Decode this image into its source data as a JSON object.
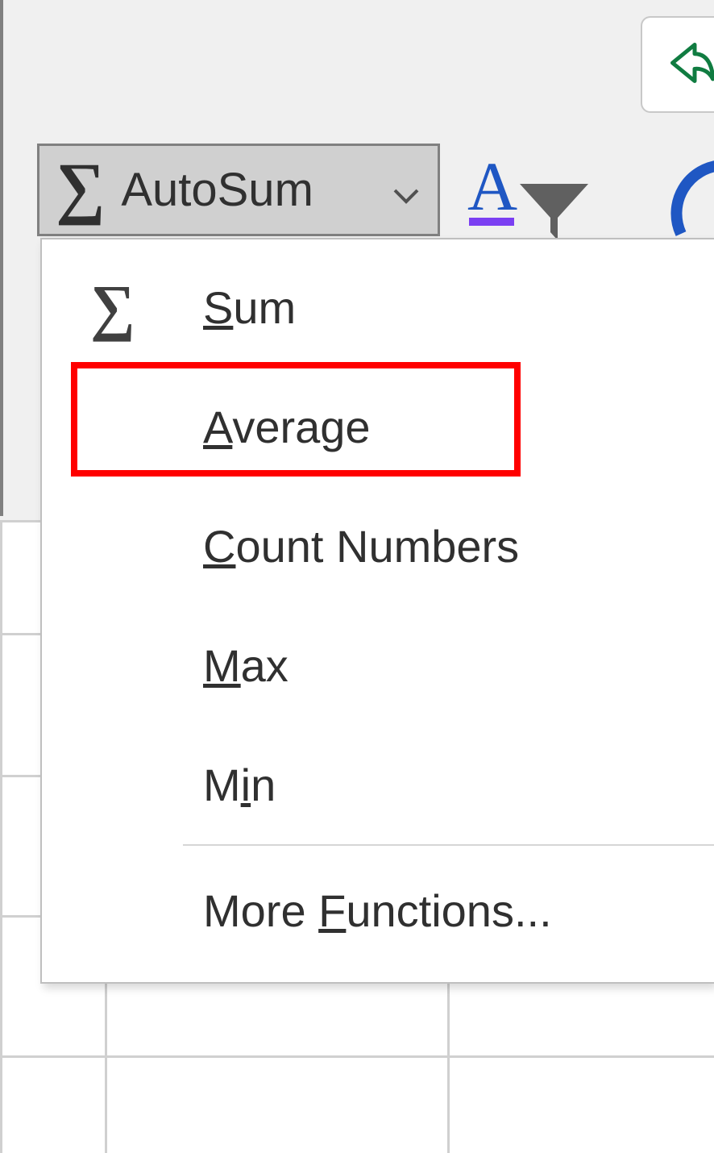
{
  "ribbon": {
    "autosum_label": "AutoSum"
  },
  "menu": {
    "items": [
      {
        "label": "Sum",
        "accel_idx": 0,
        "icon": "sigma"
      },
      {
        "label": "Average",
        "accel_idx": 0,
        "icon": ""
      },
      {
        "label": "Count Numbers",
        "accel_idx": 0,
        "icon": ""
      },
      {
        "label": "Max",
        "accel_idx": 0,
        "icon": ""
      },
      {
        "label": "Min",
        "accel_idx": 1,
        "icon": ""
      },
      {
        "label": "More Functions...",
        "accel_idx": 5,
        "icon": ""
      }
    ],
    "highlighted_index": 1
  }
}
